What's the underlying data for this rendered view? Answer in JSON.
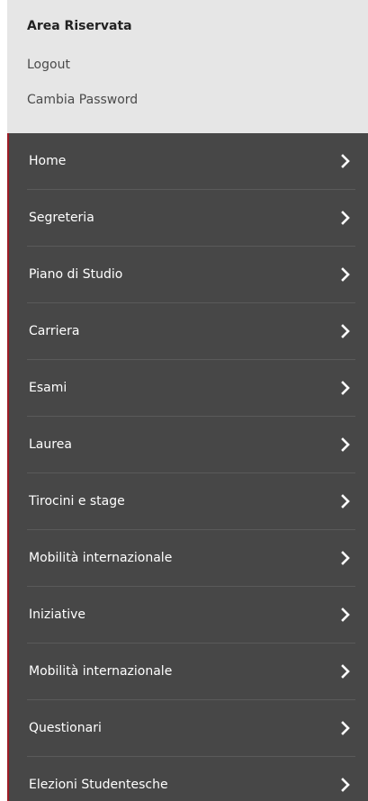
{
  "header": {
    "title": "Area Riservata",
    "logout_label": "Logout",
    "change_password_label": "Cambia Password"
  },
  "menu": {
    "items": [
      {
        "label": "Home"
      },
      {
        "label": "Segreteria"
      },
      {
        "label": "Piano di Studio"
      },
      {
        "label": "Carriera"
      },
      {
        "label": "Esami"
      },
      {
        "label": "Laurea"
      },
      {
        "label": "Tirocini e stage"
      },
      {
        "label": "Mobilità internazionale"
      },
      {
        "label": "Iniziative"
      },
      {
        "label": "Mobilità internazionale"
      },
      {
        "label": "Questionari"
      },
      {
        "label": "Elezioni Studentesche"
      }
    ],
    "chevron_icon": "chevron-right-icon"
  },
  "colors": {
    "header_bg": "#e6e6e6",
    "menu_bg": "#474747",
    "accent_border": "#9b1c26",
    "menu_text": "#ffffff"
  }
}
